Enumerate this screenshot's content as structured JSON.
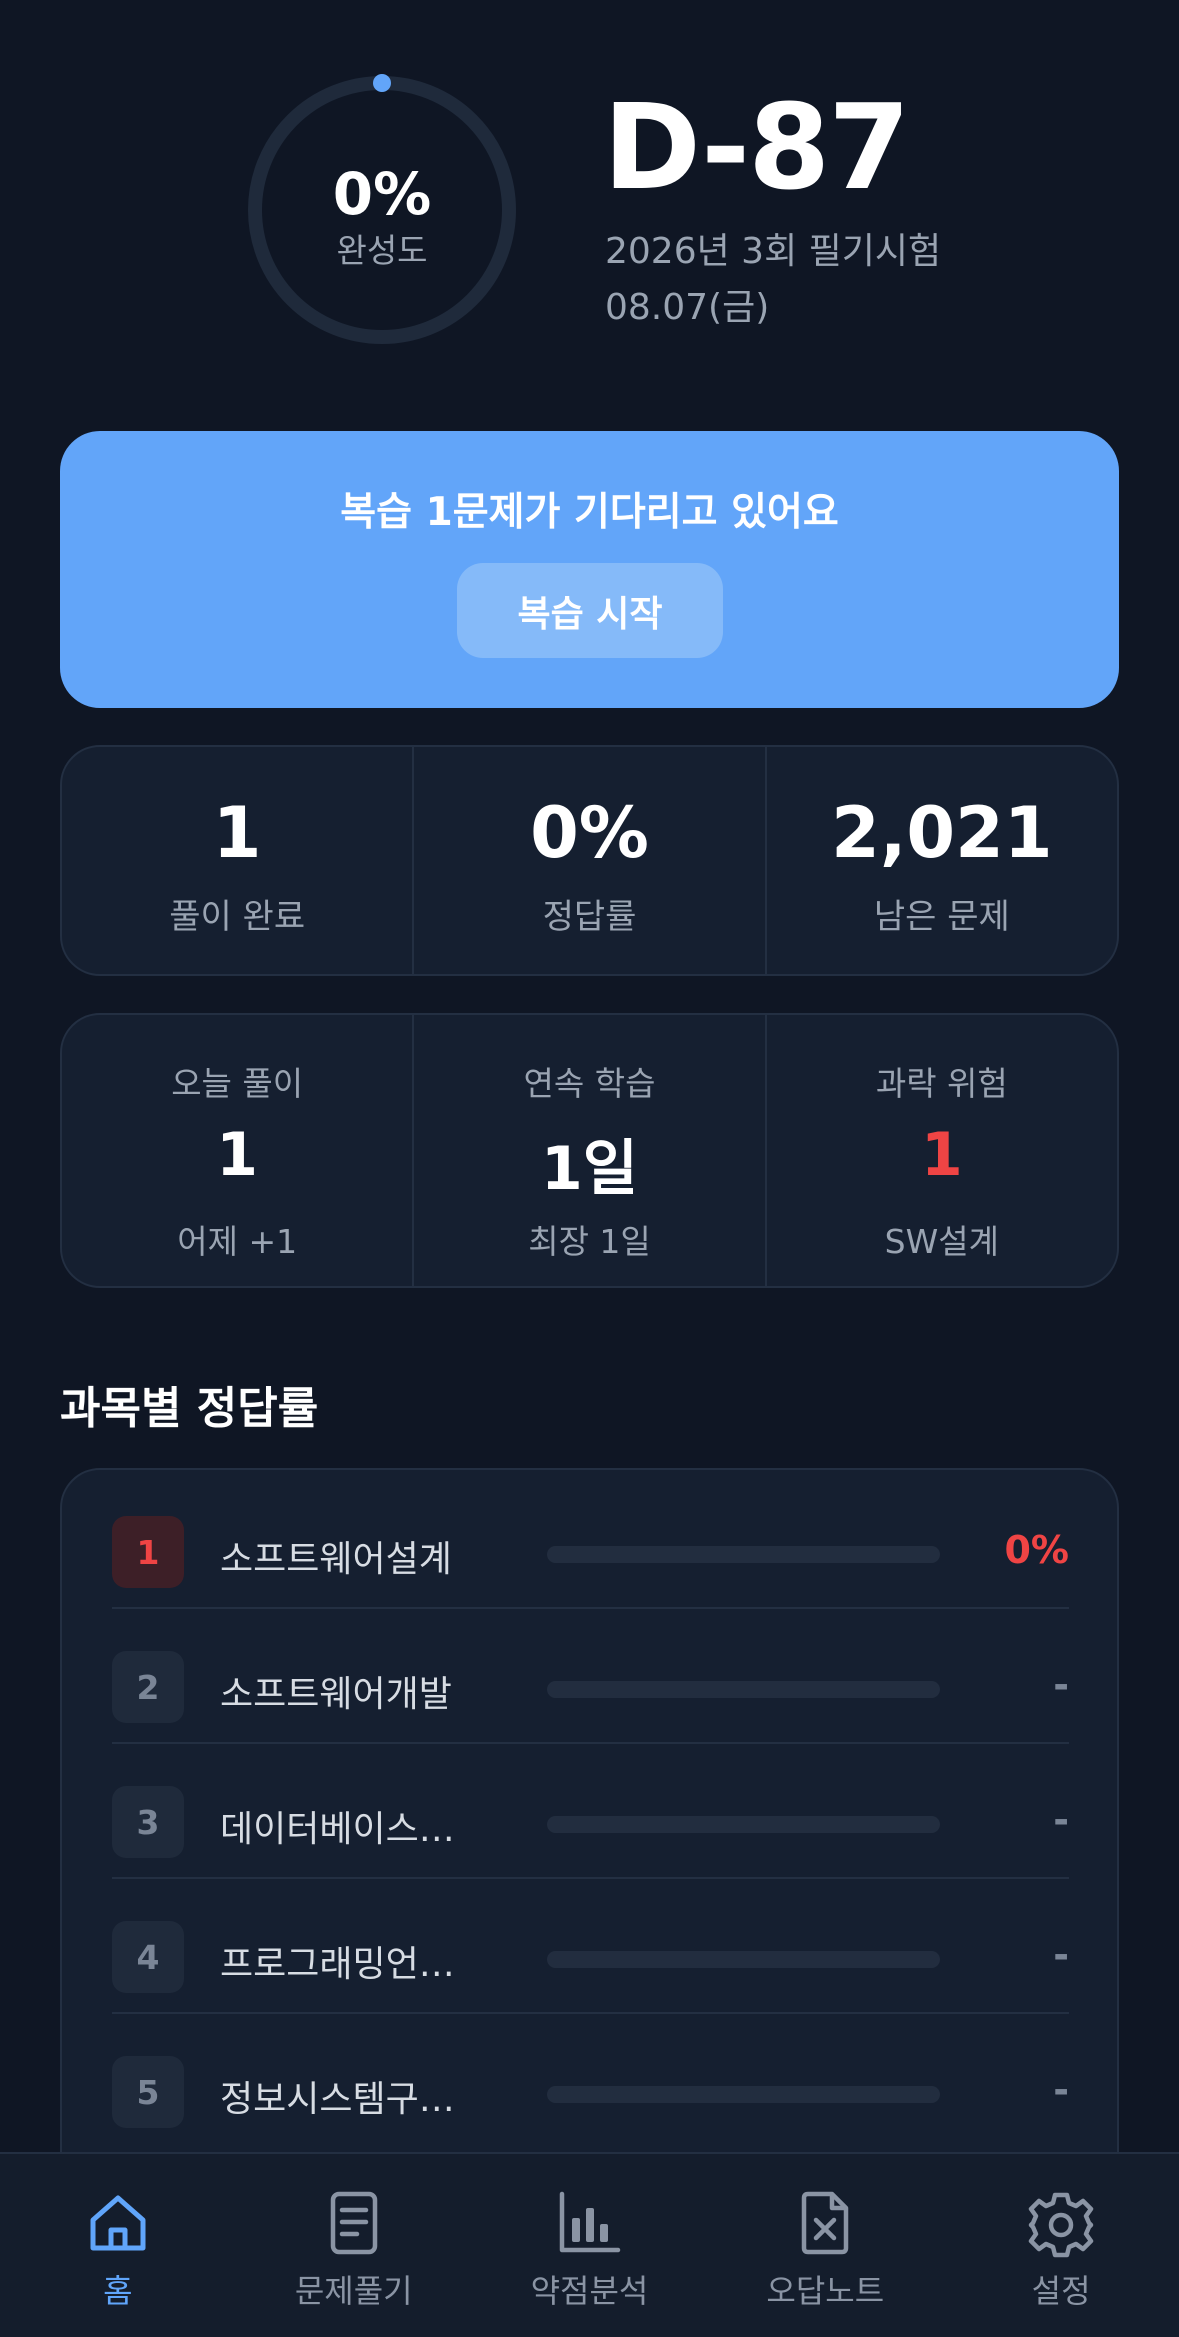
{
  "header": {
    "completion_percent": 0,
    "completion_text": "0%",
    "completion_label": "완성도",
    "dday": "D-87",
    "exam_title": "2026년 3회 필기시험",
    "exam_date": "08.07(금)"
  },
  "review": {
    "message": "복습 1문제가 기다리고 있어요",
    "button_label": "복습 시작"
  },
  "stats_primary": [
    {
      "value": "1",
      "label": "풀이 완료"
    },
    {
      "value": "0%",
      "label": "정답률"
    },
    {
      "value": "2,021",
      "label": "남은 문제"
    }
  ],
  "stats_secondary": [
    {
      "title": "오늘 풀이",
      "value": "1",
      "sub": "어제 +1"
    },
    {
      "title": "연속 학습",
      "value": "1일",
      "sub": "최장 1일"
    },
    {
      "title": "과락 위험",
      "value": "1",
      "sub": "SW설계"
    }
  ],
  "subjects": {
    "title": "과목별 정답률",
    "items": [
      {
        "rank": "1",
        "name": "소프트웨어설계",
        "accuracy": "0%"
      },
      {
        "rank": "2",
        "name": "소프트웨어개발",
        "accuracy": "-"
      },
      {
        "rank": "3",
        "name": "데이터베이스…",
        "accuracy": "-"
      },
      {
        "rank": "4",
        "name": "프로그래밍언…",
        "accuracy": "-"
      },
      {
        "rank": "5",
        "name": "정보시스템구…",
        "accuracy": "-"
      }
    ]
  },
  "nav": {
    "items": [
      {
        "label": "홈",
        "icon": "home-icon",
        "active": true
      },
      {
        "label": "문제풀기",
        "icon": "document-icon"
      },
      {
        "label": "약점분석",
        "icon": "bar-chart-icon"
      },
      {
        "label": "오답노트",
        "icon": "file-x-icon"
      },
      {
        "label": "설정",
        "icon": "gear-icon"
      }
    ]
  },
  "colors": {
    "background": "#0f1624",
    "card": "#151f30",
    "accent": "#62a5f9",
    "danger": "#ef4444",
    "muted": "#9aa4b2"
  }
}
